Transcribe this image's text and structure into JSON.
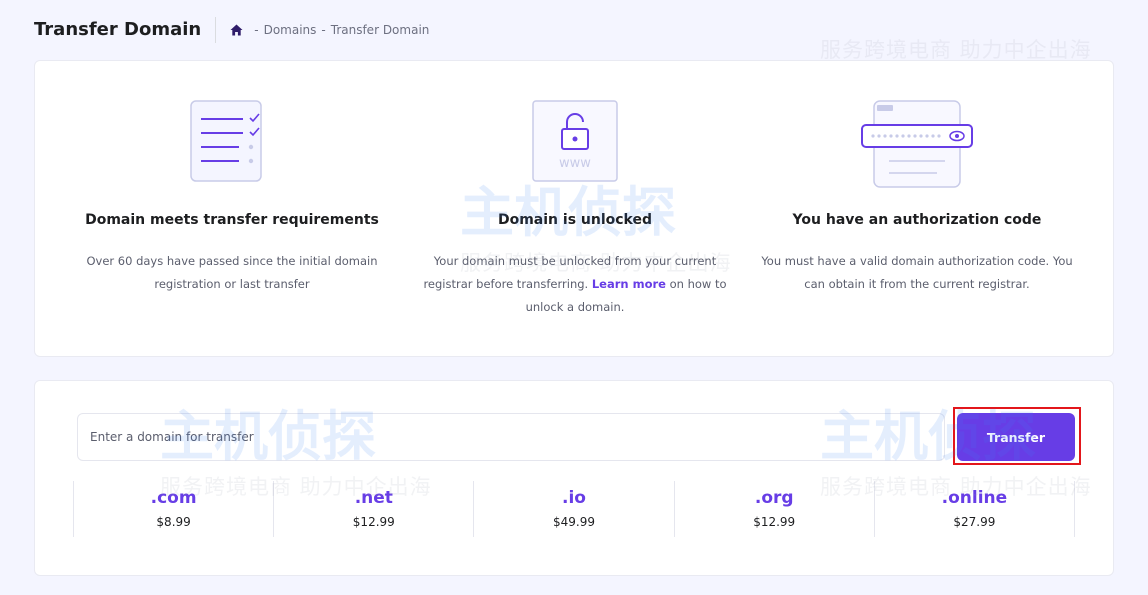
{
  "header": {
    "title": "Transfer Domain",
    "breadcrumb": {
      "items": [
        "Domains",
        "Transfer Domain"
      ],
      "separator": "-"
    }
  },
  "requirements": [
    {
      "title": "Domain meets transfer requirements",
      "description": "Over 60 days have passed since the initial domain registration or last transfer",
      "icon": "checklist-illustration"
    },
    {
      "title": "Domain is unlocked",
      "description_before": "Your domain must be unlocked from your current registrar before transferring.",
      "link_label": "Learn more",
      "description_after": "on how to unlock a domain.",
      "icon": "unlocked-www-illustration"
    },
    {
      "title": "You have an authorization code",
      "description": "You must have a valid domain authorization code. You can obtain it from the current registrar.",
      "icon": "password-field-illustration"
    }
  ],
  "search": {
    "placeholder": "Enter a domain for transfer",
    "value": "",
    "button_label": "Transfer"
  },
  "tlds": [
    {
      "name": ".com",
      "price": "$8.99"
    },
    {
      "name": ".net",
      "price": "$12.99"
    },
    {
      "name": ".io",
      "price": "$49.99"
    },
    {
      "name": ".org",
      "price": "$12.99"
    },
    {
      "name": ".online",
      "price": "$27.99"
    }
  ],
  "watermark": {
    "title": "主机侦探",
    "subtitle": "服务跨境电商 助力中企出海"
  },
  "colors": {
    "accent": "#673de6",
    "highlight": "#e3161b",
    "background": "#f4f5ff"
  }
}
